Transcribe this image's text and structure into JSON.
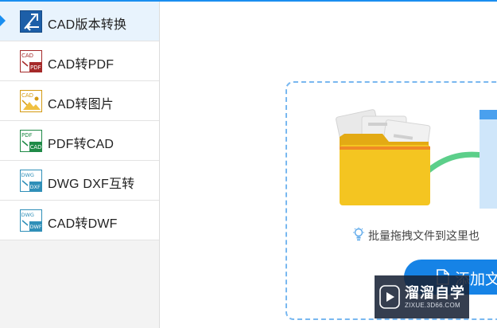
{
  "sidebar": {
    "items": [
      {
        "label": "CAD版本转换",
        "icon": "cad-version-convert-icon",
        "active": true
      },
      {
        "label": "CAD转PDF",
        "icon": "cad-to-pdf-icon",
        "badge_top": "CAD",
        "badge_bottom": "PDF",
        "color": "#a52a2a"
      },
      {
        "label": "CAD转图片",
        "icon": "cad-to-image-icon",
        "badge_top": "CAD",
        "color": "#d49a12"
      },
      {
        "label": "PDF转CAD",
        "icon": "pdf-to-cad-icon",
        "badge_top": "PDF",
        "badge_bottom": "CAD",
        "color": "#1f8a47"
      },
      {
        "label": "DWG DXF互转",
        "icon": "dwg-dxf-convert-icon",
        "badge_top": "DWG",
        "badge_bottom": "DXF",
        "color": "#2f8fb8"
      },
      {
        "label": "CAD转DWF",
        "icon": "cad-to-dwf-icon",
        "badge_top": "DWG",
        "badge_bottom": "DWF",
        "color": "#2f8fb8"
      }
    ]
  },
  "main": {
    "hint_text": "批量拖拽文件到这里也",
    "add_button_label": "添加文"
  },
  "watermark": {
    "text": "溜溜自学",
    "subtext": "ZIXUE.3D66.COM"
  },
  "colors": {
    "accent": "#1a8ef0",
    "button": "#1683e6",
    "dropzone_border": "#79b8f0",
    "folder": "#f4c521",
    "curve": "#5ccf8a"
  }
}
